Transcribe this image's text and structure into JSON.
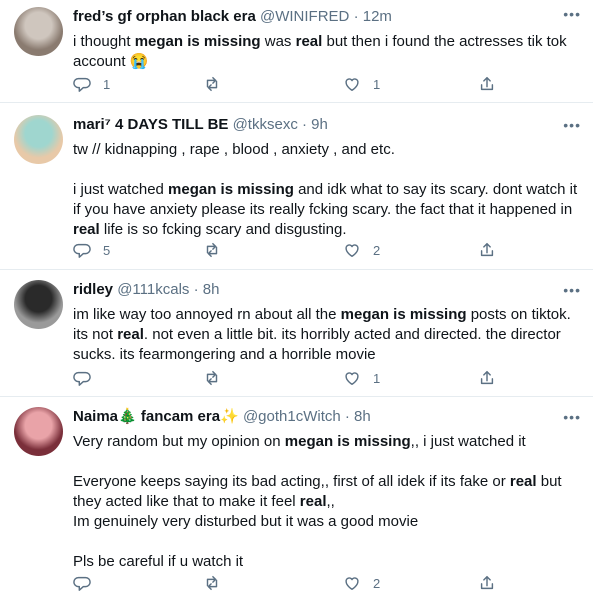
{
  "tweets": [
    {
      "name": "fred’s gf orphan black era",
      "handle": "@WINIFRED",
      "time": "12m",
      "lines": [
        [
          {
            "t": "i thought "
          },
          {
            "t": "megan is missing",
            "b": true
          },
          {
            "t": " was "
          },
          {
            "t": "real",
            "b": true
          },
          {
            "t": " but then i found the actresses tik tok"
          }
        ],
        [
          {
            "t": "account 😭"
          }
        ]
      ],
      "reply_count": "1",
      "retweet_count": "",
      "like_count": "1",
      "avatar_colors": [
        "#cfc6be",
        "#8a7b70"
      ]
    },
    {
      "name": "mari⁷ 4 DAYS TILL BE",
      "handle": "@tkksexc",
      "time": "9h",
      "lines": [
        [
          {
            "t": "tw // kidnapping , rape , blood , anxiety , and etc."
          }
        ],
        [],
        [
          {
            "t": "i just watched "
          },
          {
            "t": "megan is missing",
            "b": true
          },
          {
            "t": " and idk what to say its scary. dont watch it"
          }
        ],
        [
          {
            "t": "if you have anxiety please its really fcking scary. the fact that it happened in"
          }
        ],
        [
          {
            "t": "real",
            "b": true
          },
          {
            "t": " life is so fcking scary and disgusting."
          }
        ]
      ],
      "reply_count": "5",
      "retweet_count": "",
      "like_count": "2",
      "avatar_colors": [
        "#9fd6cf",
        "#e8c9a8"
      ]
    },
    {
      "name": "ridley",
      "handle": "@111kcals",
      "time": "8h",
      "lines": [
        [
          {
            "t": "im like way too annoyed rn about all the "
          },
          {
            "t": "megan is missing",
            "b": true
          },
          {
            "t": " posts on tiktok."
          }
        ],
        [
          {
            "t": "its not "
          },
          {
            "t": "real",
            "b": true
          },
          {
            "t": ". not even a little bit. its horribly acted and directed. the director"
          }
        ],
        [
          {
            "t": "sucks. its fearmongering and a horrible movie"
          }
        ]
      ],
      "reply_count": "",
      "retweet_count": "",
      "like_count": "1",
      "avatar_colors": [
        "#2a2a2a",
        "#9a9a9a"
      ]
    },
    {
      "name": "Naima🎄 fancam era✨",
      "handle": "@goth1cWitch",
      "time": "8h",
      "lines": [
        [
          {
            "t": "Very random but my opinion on "
          },
          {
            "t": "megan is missing",
            "b": true
          },
          {
            "t": ",, i just watched it"
          }
        ],
        [],
        [
          {
            "t": "Everyone keeps saying its bad acting,, first of all idek if its fake or "
          },
          {
            "t": "real",
            "b": true
          },
          {
            "t": " but"
          }
        ],
        [
          {
            "t": "they acted like that to make it feel "
          },
          {
            "t": "real",
            "b": true
          },
          {
            "t": ",,"
          }
        ],
        [
          {
            "t": "Im genuinely very disturbed but it was a good movie"
          }
        ],
        [],
        [
          {
            "t": "Pls be careful if u watch it"
          }
        ]
      ],
      "reply_count": "",
      "retweet_count": "",
      "like_count": "2",
      "avatar_colors": [
        "#e9a3a8",
        "#7a2f3a"
      ]
    }
  ]
}
